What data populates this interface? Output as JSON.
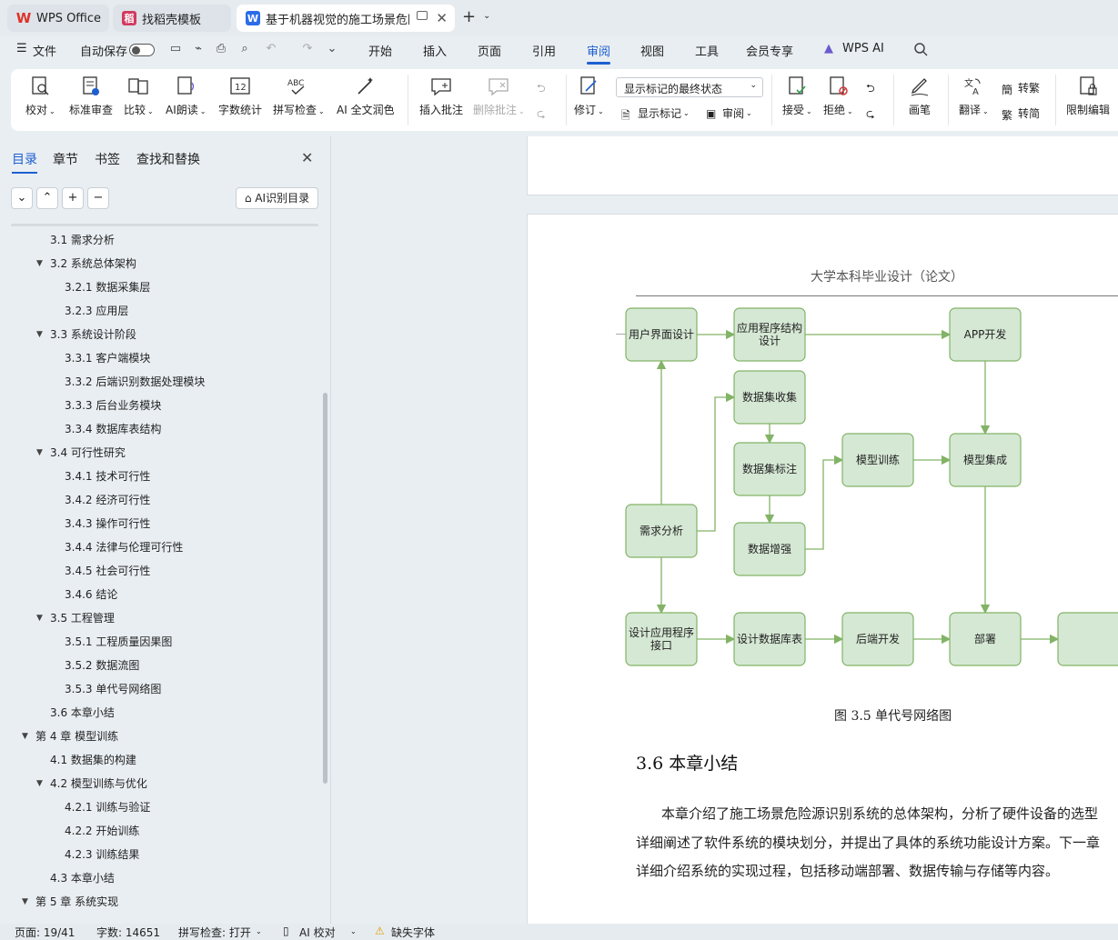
{
  "tabs": [
    {
      "label": "WPS Office"
    },
    {
      "label": "找稻壳模板"
    },
    {
      "label": "基于机器视觉的施工场景危险"
    }
  ],
  "menu": {
    "file": "文件",
    "autosave": "自动保存",
    "items": [
      "开始",
      "插入",
      "页面",
      "引用",
      "审阅",
      "视图",
      "工具",
      "会员专享",
      "WPS AI"
    ],
    "active": "审阅"
  },
  "ribbon": {
    "proofread": "校对",
    "standard_review": "标准审查",
    "compare": "比较",
    "ai_read": "AI朗读",
    "word_count": "字数统计",
    "spell_check": "拼写检查",
    "ai_polish": "AI 全文润色",
    "insert_comment": "插入批注",
    "delete_comment": "删除批注",
    "revise": "修订",
    "markup_state": "显示标记的最终状态",
    "show_markup": "显示标记",
    "review": "审阅",
    "accept": "接受",
    "reject": "拒绝",
    "pen": "画笔",
    "translate": "翻译",
    "to_traditional": "转繁",
    "to_simplified": "转简",
    "restrict_edit": "限制编辑"
  },
  "nav": {
    "tabs": [
      "目录",
      "章节",
      "书签",
      "查找和替换"
    ],
    "ai_toc": "AI识别目录",
    "toc": [
      {
        "label": "3.1 需求分析",
        "level": 2,
        "expand": false
      },
      {
        "label": "3.2 系统总体架构",
        "level": 2,
        "expand": true
      },
      {
        "label": "3.2.1 数据采集层",
        "level": 3,
        "expand": false
      },
      {
        "label": "3.2.3 应用层",
        "level": 3,
        "expand": false
      },
      {
        "label": "3.3 系统设计阶段",
        "level": 2,
        "expand": true
      },
      {
        "label": "3.3.1 客户端模块",
        "level": 3,
        "expand": false
      },
      {
        "label": "3.3.2 后端识别数据处理模块",
        "level": 3,
        "expand": false
      },
      {
        "label": "3.3.3 后台业务模块",
        "level": 3,
        "expand": false
      },
      {
        "label": "3.3.4 数据库表结构",
        "level": 3,
        "expand": false
      },
      {
        "label": "3.4 可行性研究",
        "level": 2,
        "expand": true
      },
      {
        "label": "3.4.1 技术可行性",
        "level": 3,
        "expand": false
      },
      {
        "label": "3.4.2 经济可行性",
        "level": 3,
        "expand": false
      },
      {
        "label": "3.4.3 操作可行性",
        "level": 3,
        "expand": false
      },
      {
        "label": "3.4.4 法律与伦理可行性",
        "level": 3,
        "expand": false
      },
      {
        "label": "3.4.5 社会可行性",
        "level": 3,
        "expand": false
      },
      {
        "label": "3.4.6 结论",
        "level": 3,
        "expand": false
      },
      {
        "label": "3.5 工程管理",
        "level": 2,
        "expand": true
      },
      {
        "label": "3.5.1 工程质量因果图",
        "level": 3,
        "expand": false
      },
      {
        "label": "3.5.2 数据流图",
        "level": 3,
        "expand": false
      },
      {
        "label": "3.5.3 单代号网络图",
        "level": 3,
        "expand": false
      },
      {
        "label": "3.6 本章小结",
        "level": 2,
        "expand": false
      },
      {
        "label": "第 4 章  模型训练",
        "level": 1,
        "expand": true
      },
      {
        "label": "4.1 数据集的构建",
        "level": 2,
        "expand": false
      },
      {
        "label": "4.2 模型训练与优化",
        "level": 2,
        "expand": true
      },
      {
        "label": "4.2.1 训练与验证",
        "level": 3,
        "expand": false
      },
      {
        "label": "4.2.2 开始训练",
        "level": 3,
        "expand": false
      },
      {
        "label": "4.2.3 训练结果",
        "level": 3,
        "expand": false
      },
      {
        "label": "4.3 本章小结",
        "level": 2,
        "expand": false
      },
      {
        "label": "第 5 章  系统实现",
        "level": 1,
        "expand": true
      }
    ]
  },
  "document": {
    "header": "大学本科毕业设计（论文）",
    "diagram_nodes": [
      {
        "id": "ui",
        "label": "用户界面设计"
      },
      {
        "id": "app_struct",
        "label": "应用程序结构设计"
      },
      {
        "id": "app_dev",
        "label": "APP开发"
      },
      {
        "id": "collect",
        "label": "数据集收集"
      },
      {
        "id": "annotate",
        "label": "数据集标注"
      },
      {
        "id": "train",
        "label": "模型训练"
      },
      {
        "id": "integrate",
        "label": "模型集成"
      },
      {
        "id": "req",
        "label": "需求分析"
      },
      {
        "id": "augment",
        "label": "数据增强"
      },
      {
        "id": "api",
        "label": "设计应用程序接口"
      },
      {
        "id": "db",
        "label": "设计数据库表"
      },
      {
        "id": "backend",
        "label": "后端开发"
      },
      {
        "id": "deploy",
        "label": "部署"
      },
      {
        "id": "last",
        "label": ""
      }
    ],
    "caption": "图 3.5 单代号网络图",
    "section_title": "3.6 本章小结",
    "paragraph_lines": [
      "本章介绍了施工场景危险源识别系统的总体架构，分析了硬件设备的选型",
      "详细阐述了软件系统的模块划分，并提出了具体的系统功能设计方案。下一章",
      "详细介绍系统的实现过程，包括移动端部署、数据传输与存储等内容。"
    ]
  },
  "status": {
    "page": "页面: 19/41",
    "words": "字数: 14651",
    "spell": "拼写检查: 打开",
    "ai_proof": "AI 校对",
    "missing_font": "缺失字体"
  },
  "colors": {
    "accent": "#1d5fd1",
    "node_fill": "#d5e8d4",
    "node_stroke": "#82b366"
  }
}
